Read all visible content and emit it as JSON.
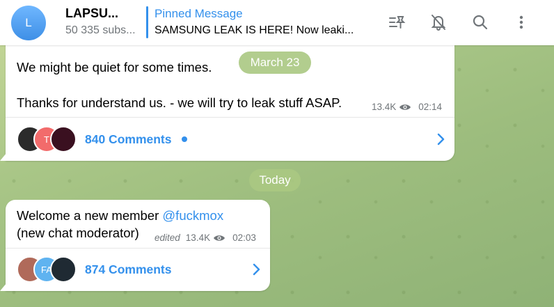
{
  "header": {
    "avatar_letter": "L",
    "channel_title": "LAPSU...",
    "channel_subscribers": "50 335 subs...",
    "pinned_title": "Pinned Message",
    "pinned_text": "SAMSUNG LEAK IS HERE! Now leaki...",
    "icons": [
      "pinned-list-icon",
      "bell-muted-icon",
      "search-icon",
      "more-vertical-icon"
    ]
  },
  "date_pills": {
    "first": "March 23",
    "second": "Today"
  },
  "messages": [
    {
      "line1": "We might be quiet for some times.",
      "line2": "Thanks for understand us. - we will try to leak stuff ASAP.",
      "views": "13.4K",
      "time": "02:14",
      "comments_label": "840 Comments",
      "commenter_initials": [
        "",
        "T",
        ""
      ]
    },
    {
      "text_before": "Welcome a new member ",
      "mention": "@fuckmox",
      "line2": "(new chat moderator)",
      "edited": "edited",
      "views": "13.4K",
      "time": "02:03",
      "comments_label": "874 Comments",
      "commenter_initials": [
        "",
        "FA",
        ""
      ]
    }
  ],
  "colors": {
    "accent": "#3390ec",
    "muted": "#707579",
    "avatar_t": "#f26b6b",
    "avatar_fa": "#5fb3f0"
  }
}
